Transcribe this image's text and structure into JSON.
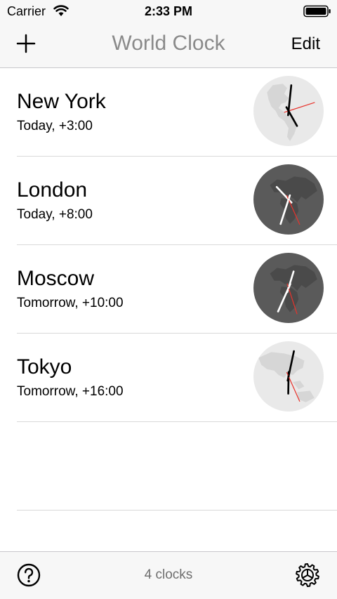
{
  "status_bar": {
    "carrier": "Carrier",
    "time": "2:33 PM",
    "wifi_icon": "wifi-icon",
    "battery_icon": "battery-icon"
  },
  "nav": {
    "title": "World Clock",
    "add_icon": "plus-icon",
    "edit_label": "Edit"
  },
  "clocks": [
    {
      "city": "New York",
      "offset": "Today, +3:00",
      "theme": "light",
      "hour": 5,
      "minute": 1,
      "second": 12
    },
    {
      "city": "London",
      "offset": "Today, +8:00",
      "theme": "dark",
      "hour": 10,
      "minute": 33,
      "second": 26
    },
    {
      "city": "Moscow",
      "offset": "Tomorrow, +10:00",
      "theme": "dark",
      "hour": 0,
      "minute": 34,
      "second": 27
    },
    {
      "city": "Tokyo",
      "offset": "Tomorrow, +16:00",
      "theme": "light",
      "hour": 6,
      "minute": 2,
      "second": 26
    }
  ],
  "toolbar": {
    "count_label": "4 clocks",
    "help_icon": "question-circle-icon",
    "settings_icon": "gear-icon"
  },
  "colors": {
    "bar_background": "#f7f7f7",
    "title_gray": "#8a8a8a",
    "separator": "#d9d9d9",
    "globe_light": "#e9e9e9",
    "globe_dark": "#5a5a5a",
    "second_hand": "#e8332c"
  }
}
